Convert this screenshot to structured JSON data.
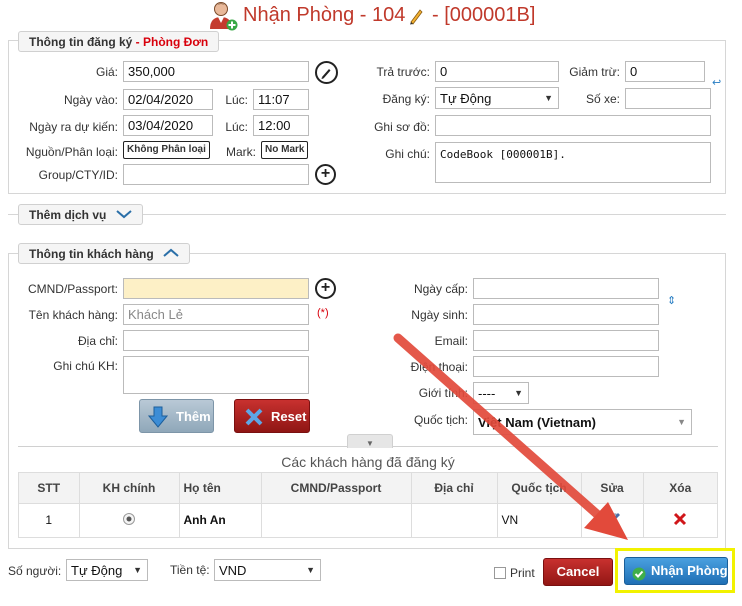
{
  "window": {
    "title": "Nhận Phòng - 104",
    "title_code": "- [000001B]"
  },
  "registration": {
    "legend": "Thông tin đăng ký",
    "legend_room_type": "- Phòng Đơn",
    "price_label": "Giá:",
    "price_value": "350,000",
    "checkin_date_label": "Ngày vào:",
    "checkin_date_value": "02/04/2020",
    "checkin_time_label": "Lúc:",
    "checkin_time_value": "11:07",
    "checkout_date_label": "Ngày ra dự kiến:",
    "checkout_date_value": "03/04/2020",
    "checkout_time_label": "Lúc:",
    "checkout_time_value": "12:00",
    "source_label": "Nguồn/Phân loại:",
    "source_button": "Không Phân loại",
    "mark_label": "Mark:",
    "mark_button": "No Mark",
    "group_label": "Group/CTY/ID:",
    "group_value": "",
    "prepaid_label": "Trả trước:",
    "prepaid_value": "0",
    "discount_label": "Giảm trừ:",
    "discount_value": "0",
    "register_label": "Đăng ký:",
    "register_value": "Tự Động",
    "vehicle_label": "Số xe:",
    "vehicle_value": "",
    "diagram_note_label": "Ghi sơ đồ:",
    "diagram_note_value": "",
    "note_label": "Ghi chú:",
    "note_value": "CodeBook [000001B]."
  },
  "services": {
    "legend": "Thêm dịch vụ"
  },
  "customer": {
    "legend": "Thông tin khách hàng",
    "id_label": "CMND/Passport:",
    "id_value": "",
    "name_label": "Tên khách hàng:",
    "name_placeholder": "Khách Lẻ",
    "required_mark": "(*)",
    "address_label": "Địa chỉ:",
    "address_value": "",
    "note_label": "Ghi chú KH:",
    "note_value": "",
    "issue_date_label": "Ngày cấp:",
    "issue_date_value": "",
    "dob_label": "Ngày sinh:",
    "dob_value": "",
    "email_label": "Email:",
    "email_value": "",
    "phone_label": "Điện thoại:",
    "phone_value": "",
    "gender_label": "Giới tính:",
    "gender_value": "----",
    "nationality_label": "Quốc tịch:",
    "nationality_value": "Việt Nam (Vietnam)",
    "add_button": "Thêm",
    "reset_button": "Reset"
  },
  "guest_table": {
    "title": "Các khách hàng đã đăng ký",
    "columns": [
      "STT",
      "KH chính",
      "Họ tên",
      "CMND/Passport",
      "Địa chỉ",
      "Quốc tịch",
      "Sửa",
      "Xóa"
    ],
    "rows": [
      {
        "stt": "1",
        "name": "Anh An",
        "id": "",
        "address": "",
        "nationality": "VN"
      }
    ]
  },
  "footer": {
    "people_label": "Số người:",
    "people_value": "Tự Động",
    "currency_label": "Tiền tệ:",
    "currency_value": "VND",
    "print_label": "Print",
    "cancel_button": "Cancel",
    "checkin_button": "Nhận Phòng"
  },
  "colors": {
    "title": "#c0392b",
    "room_type": "#d8000c",
    "cancel_bg": "#b3191c",
    "checkin_bg": "#2a7fc4",
    "highlight": "#f2f200",
    "arrow": "#e24a3b"
  }
}
